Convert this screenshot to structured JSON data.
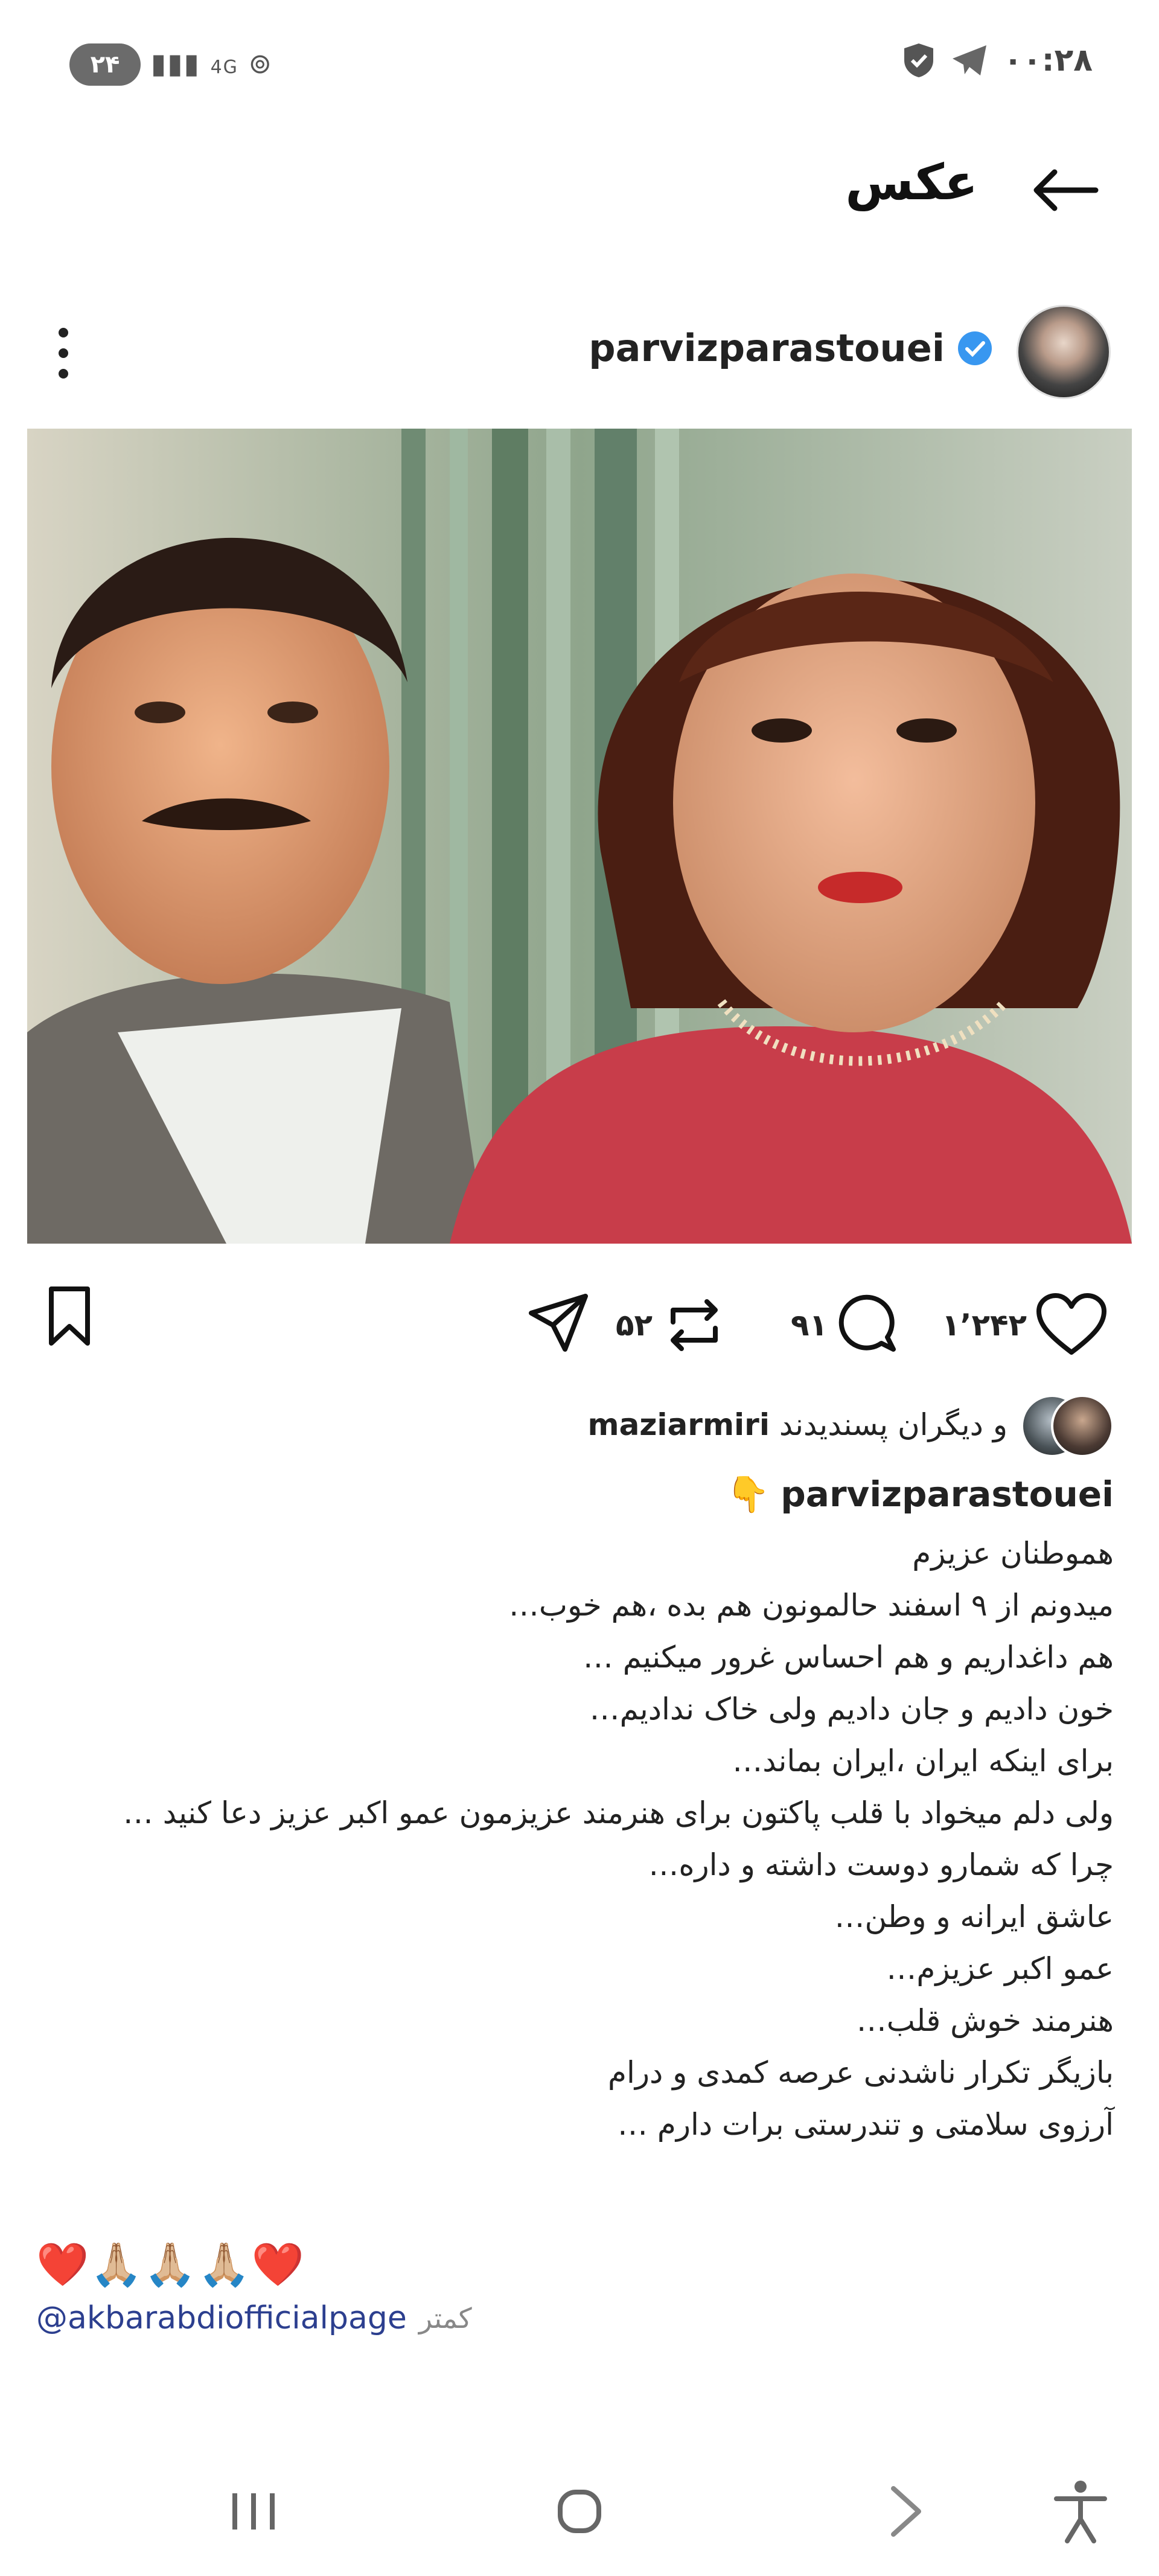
{
  "status_bar": {
    "badge": "۲۴",
    "network": "4G",
    "time": "۰۰:۲۸"
  },
  "header": {
    "title": "عکس"
  },
  "post": {
    "username": "parvizparastouei",
    "verified": true,
    "likes": "۱٬۲۴۲",
    "comments": "۹۱",
    "reposts": "۵۲",
    "liked_by_prefix": "و دیگران پسندیدند",
    "liked_by_user": "maziarmiri"
  },
  "caption": {
    "username": "parvizparastouei",
    "emoji": "👇",
    "lines": [
      "هموطنان عزیزم",
      "میدونم از ۹ اسفند حالمونون هم بده ،هم خوب…",
      "هم داغداریم و هم احساس غرور میکنیم …",
      "خون دادیم و جان دادیم ولی خاک ندادیم…",
      "برای اینکه ایران ،ایران بماند…",
      "ولی دلم میخواد با قلب پاکتون برای هنرمند عزیزمون عمو اکبر عزیز دعا کنید …",
      "چرا که شمارو دوست داشته و  داره…",
      "عاشق ایرانه و وطن…",
      "عمو اکبر عزیزم…",
      "هنرمند خوش قلب…",
      "بازیگر تکرار ناشدنی  عرصه  کمدی و درام",
      "آرزوی سلامتی و تندرستی برات دارم …"
    ],
    "hearts": "❤️🙏🏼🙏🏼🙏🏼❤️",
    "mention": "@akbarabdiofficialpage",
    "less": "کمتر"
  },
  "icons": {
    "back": "arrow-left-icon",
    "more": "more-vertical-icon",
    "bookmark": "bookmark-icon",
    "share": "send-icon",
    "repost": "repost-icon",
    "comment": "comment-icon",
    "like": "heart-icon"
  },
  "colors": {
    "verified": "#3897f0",
    "mention": "#2c3f8f"
  }
}
